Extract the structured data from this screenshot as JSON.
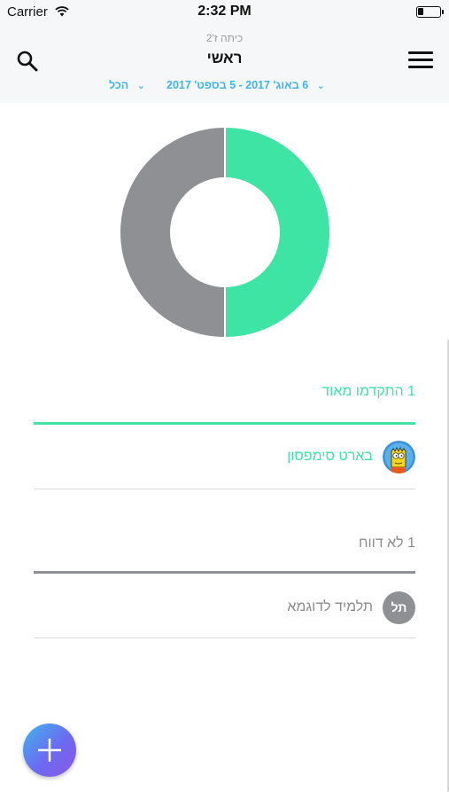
{
  "status_bar": {
    "carrier": "Carrier",
    "time": "2:32 PM"
  },
  "header": {
    "class_name": "כיתה ז'2",
    "title": "ראשי",
    "date_range": "6 באוג' 2017 - 5 בספט' 2017",
    "filter_all": "הכל"
  },
  "chart_data": {
    "type": "pie",
    "donut": true,
    "slices": [
      {
        "value": 1,
        "color": "#3ee4a3"
      },
      {
        "value": 1,
        "color": "#8e9093"
      }
    ]
  },
  "groups": [
    {
      "header": "1 התקדמו מאוד",
      "color": "#3ee4a3",
      "students": [
        {
          "name": "בארט סימפסון",
          "avatar": "bart-simpson-avatar"
        }
      ]
    },
    {
      "header": "1 לא דווח",
      "color": "#8e9093",
      "students": [
        {
          "name": "תלמיד לדוגמא",
          "initials": "תל"
        }
      ]
    }
  ],
  "colors": {
    "accent_blue": "#3fb4e6",
    "positive_green": "#3ee4a3",
    "neutral_gray": "#8e9093"
  },
  "icons": {
    "search": "search-icon",
    "menu": "hamburger-menu-icon",
    "add": "plus-icon"
  }
}
